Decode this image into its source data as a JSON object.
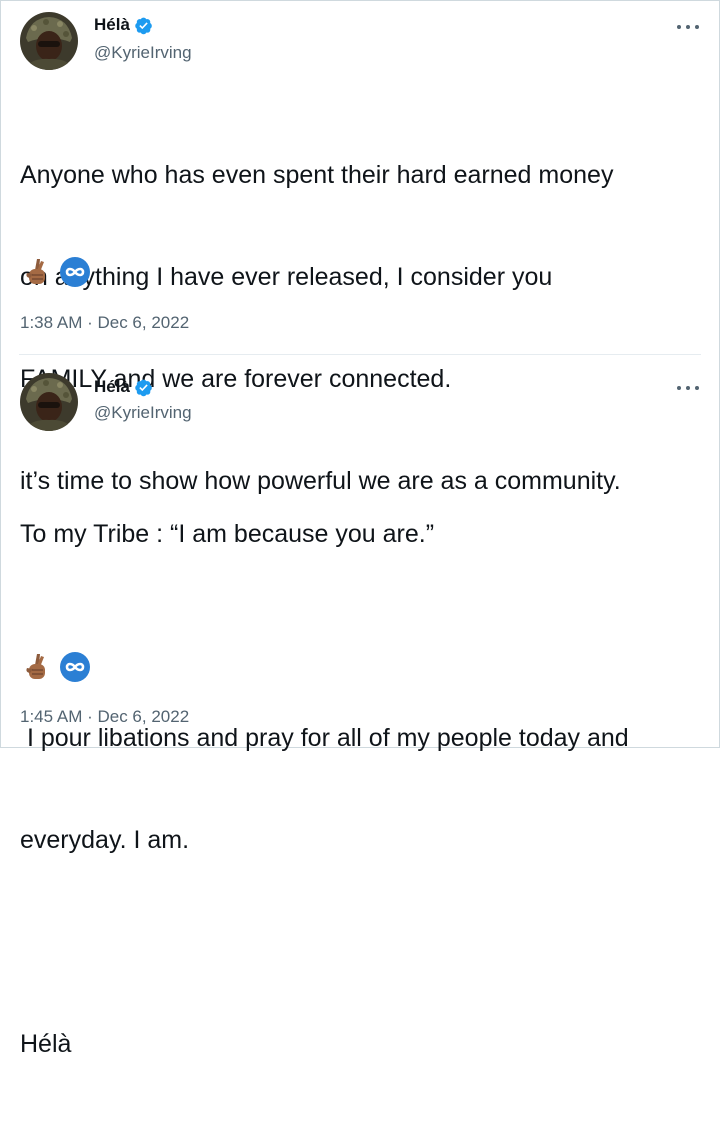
{
  "tweets": [
    {
      "author": {
        "display_name": "Hélà",
        "handle": "@KyrieIrving",
        "verified": true
      },
      "text_lines": [
        "Anyone who has even spent their hard earned money",
        "on anything I have ever released, I consider you",
        "FAMILY and we are forever connected.",
        "it’s time to show how powerful we are as a community."
      ],
      "emojis": [
        "crossed-fingers-emoji",
        "infinity-emoji"
      ],
      "timestamp": "1:38 AM · Dec 6, 2022"
    },
    {
      "author": {
        "display_name": "Hélà",
        "handle": "@KyrieIrving",
        "verified": true
      },
      "text_lines": [
        "To my Tribe : “I am because you are.”",
        "",
        " I pour libations and pray for all of my people today and",
        "everyday. I am.",
        "",
        "Hélà"
      ],
      "emojis": [
        "crossed-fingers-emoji",
        "infinity-emoji"
      ],
      "timestamp": "1:45 AM · Dec 6, 2022"
    }
  ],
  "colors": {
    "text": "#0f1419",
    "secondary": "#536471",
    "verified_blue": "#1d9bf0",
    "border": "#cfd9de"
  }
}
